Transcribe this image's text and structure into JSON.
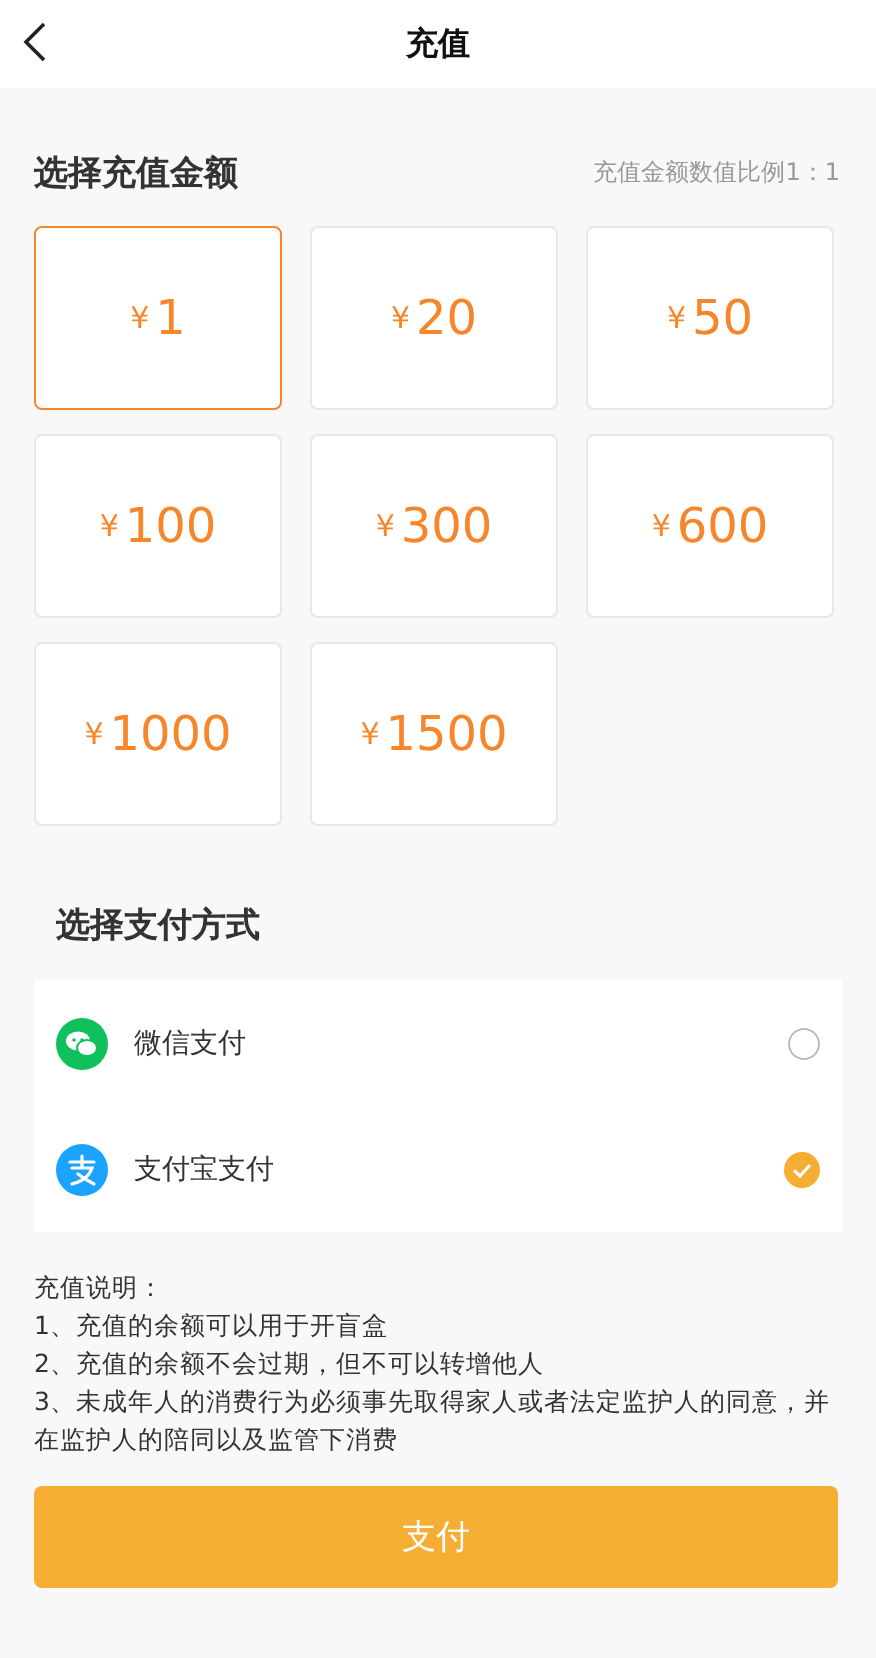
{
  "header": {
    "title": "充值"
  },
  "amount_section": {
    "title": "选择充值金额",
    "ratio_note": "充值金额数值比例1：1",
    "options": [
      {
        "currency": "¥",
        "amount": "1",
        "selected": true
      },
      {
        "currency": "¥",
        "amount": "20",
        "selected": false
      },
      {
        "currency": "¥",
        "amount": "50",
        "selected": false
      },
      {
        "currency": "¥",
        "amount": "100",
        "selected": false
      },
      {
        "currency": "¥",
        "amount": "300",
        "selected": false
      },
      {
        "currency": "¥",
        "amount": "600",
        "selected": false
      },
      {
        "currency": "¥",
        "amount": "1000",
        "selected": false
      },
      {
        "currency": "¥",
        "amount": "1500",
        "selected": false
      }
    ]
  },
  "payment_section": {
    "title": "选择支付方式",
    "methods": [
      {
        "kind": "wechat",
        "label": "微信支付",
        "selected": false
      },
      {
        "kind": "alipay",
        "label": "支付宝支付",
        "selected": true
      }
    ]
  },
  "notes": {
    "title": "充值说明：",
    "lines": [
      "1、充值的余额可以用于开盲盒",
      "2、充值的余额不会过期，但不可以转增他人",
      "3、未成年人的消费行为必须事先取得家人或者法定监护人的同意，并在监护人的陪同以及监管下消费"
    ]
  },
  "pay_button": {
    "label": "支付"
  }
}
